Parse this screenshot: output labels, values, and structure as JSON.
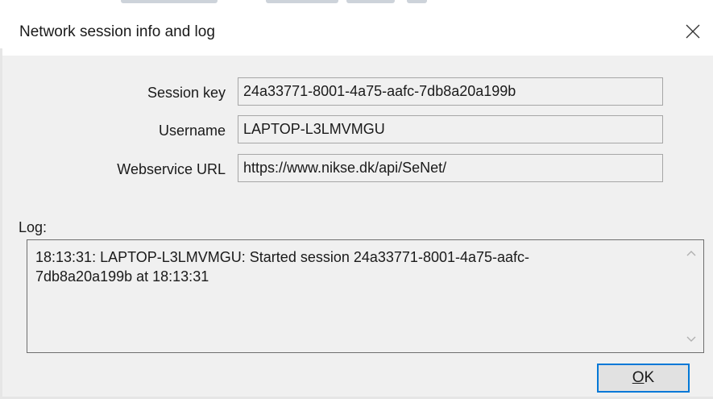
{
  "window": {
    "title": "Network session info and log"
  },
  "form": {
    "session_key": {
      "label": "Session key",
      "value": "24a33771-8001-4a75-aafc-7db8a20a199b"
    },
    "username": {
      "label": "Username",
      "value": "LAPTOP-L3LMVMGU"
    },
    "webservice_url": {
      "label": "Webservice URL",
      "value": "https://www.nikse.dk/api/SeNet/"
    }
  },
  "log": {
    "label": "Log:",
    "text": "18:13:31: LAPTOP-L3LMVMGU: Started session 24a33771-8001-4a75-aafc-\n7db8a20a199b at 18:13:31"
  },
  "buttons": {
    "ok_mnemonic": "O",
    "ok_rest": "K"
  },
  "icons": {
    "close": "close-icon",
    "scroll_up": "chevron-up-icon",
    "scroll_down": "chevron-down-icon"
  },
  "colors": {
    "accent": "#0078d7",
    "window_bg": "#f0f0f0",
    "titlebar_bg": "#ffffff"
  }
}
